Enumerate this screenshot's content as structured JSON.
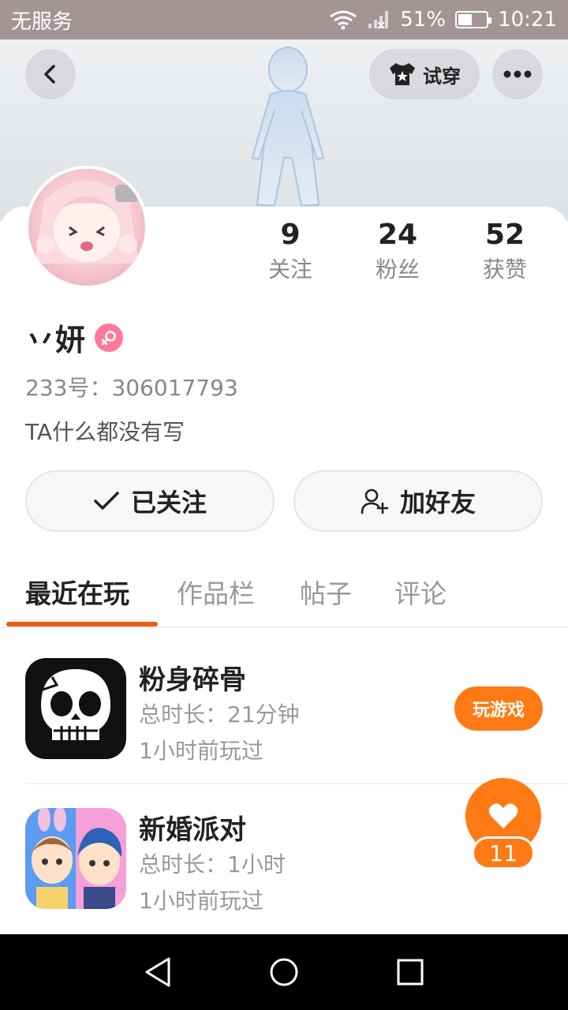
{
  "status_bar": {
    "carrier": "无服务",
    "battery_percent": "51%",
    "battery_level": 0.51,
    "time": "10:21"
  },
  "header": {
    "tryon_label": "试穿"
  },
  "profile": {
    "name": "丷妍",
    "uid": "233号：306017793",
    "bio": "TA什么都没有写",
    "stats": [
      {
        "value": "9",
        "label": "关注"
      },
      {
        "value": "24",
        "label": "粉丝"
      },
      {
        "value": "52",
        "label": "获赞"
      }
    ]
  },
  "actions": {
    "follow_label": "已关注",
    "add_friend_label": "加好友"
  },
  "tabs": [
    "最近在玩",
    "作品栏",
    "帖子",
    "评论"
  ],
  "games": [
    {
      "title": "粉身碎骨",
      "duration": "总时长：21分钟",
      "last_played": "1小时前玩过",
      "play_label": "玩游戏"
    },
    {
      "title": "新婚派对",
      "duration": "总时长：1小时",
      "last_played": "1小时前玩过"
    }
  ],
  "like": {
    "count": "11"
  },
  "colors": {
    "accent": "#ff7a14",
    "tab_indicator": "#f05a14",
    "gender": "#ff7a9c"
  }
}
